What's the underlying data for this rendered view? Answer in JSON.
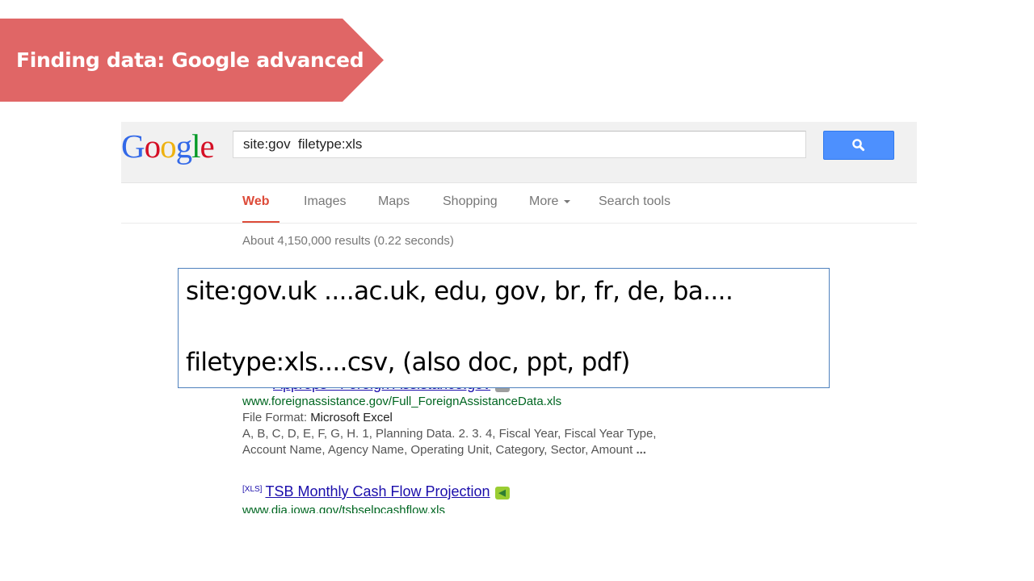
{
  "slide": {
    "title": "Finding data: Google advanced",
    "banner_color": "#e06666"
  },
  "google": {
    "logo_letters": [
      "G",
      "o",
      "o",
      "g",
      "l",
      "e"
    ],
    "query": "site:gov  filetype:xls",
    "search_button_icon": "magnifier-icon",
    "tabs": [
      {
        "label": "Web",
        "active": true
      },
      {
        "label": "Images",
        "active": false
      },
      {
        "label": "Maps",
        "active": false
      },
      {
        "label": "Shopping",
        "active": false
      },
      {
        "label": "More",
        "active": false
      },
      {
        "label": "Search tools",
        "active": false
      }
    ],
    "result_stats": "About 4,150,000 results (0.22 seconds)",
    "results": [
      {
        "title": "Approps - Foreign Assistance.gov",
        "url": "www.foreignassistance.gov/Full_ForeignAssistanceData.xls",
        "file_format_label": "File Format:",
        "file_format_value": "Microsoft Excel",
        "snippet_line1": "A, B, C, D, E, F, G, H. 1, Planning Data. 2. 3. 4, Fiscal Year, Fiscal Year Type,",
        "snippet_line2": "Account Name, Agency Name, Operating Unit, Category, Sector, Amount",
        "snippet_ellipsis": "..."
      },
      {
        "badge": "[XLS]",
        "title": "TSB Monthly Cash Flow Projection",
        "url": "www.dia.iowa.gov/tsbselpcashflow.xls"
      }
    ]
  },
  "callout": {
    "line1": "site:gov.uk ....ac.uk, edu, gov, br, fr, de, ba....",
    "line2": "filetype:xls....csv, (also doc, ppt, pdf)"
  }
}
